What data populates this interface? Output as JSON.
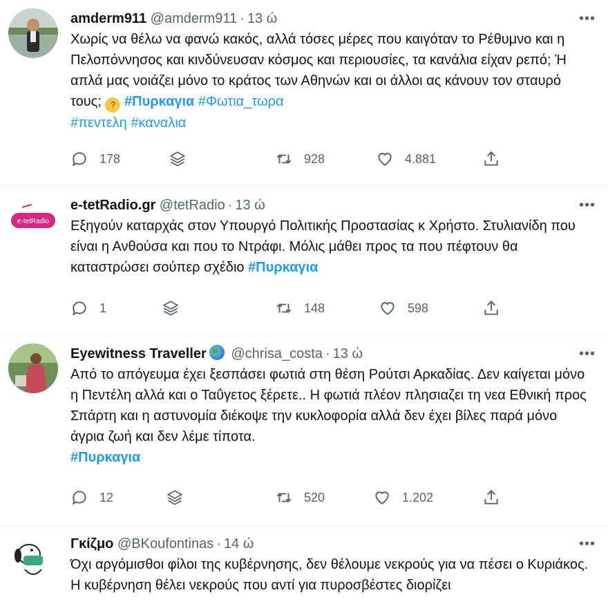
{
  "tweets": [
    {
      "name": "amderm911",
      "handle": "@amderm911",
      "time": "13 ώ",
      "text": "Χωρίς να θέλω να φανώ κακός, αλλά τόσες μέρες που καιγόταν το Ρέθυμνο και η Πελοπόννησος και κινδύνευσαν κόσμος και περιουσίες, τα κανάλια είχαν ρεπό; Ή απλά μας νοιάζει μόνο το κράτος των Αθηνών και οι άλλοι ας κάνουν τον σταυρό τους; ",
      "tags": [
        "#Πυρκαγια",
        "#Φωτια_τωρα",
        "#πεντελη",
        "#καναλια"
      ],
      "replies": "178",
      "retweets": "928",
      "likes": "4.881"
    },
    {
      "name": "e-tetRadio.gr",
      "handle": "@tetRadio",
      "time": "13 ώ",
      "avatar_text": "e-tetRadio",
      "text": "Εξηγούν καταρχάς στον Υπουργό Πολιτικής Προστασίας κ Χρήστο. Στυλιανίδη που είναι η Ανθούσα και που το Ντράφι. Μόλις μάθει προς τα που πέφτουν θα καταστρώσει σούπερ σχέδιο ",
      "tags": [
        "#Πυρκαγια"
      ],
      "replies": "1",
      "retweets": "148",
      "likes": "598"
    },
    {
      "name": "Eyewitness Traveller",
      "handle": "@chrisa_costa",
      "time": "13 ώ",
      "text": "Από το απόγευμα έχει ξεσπάσει φωτιά στη θέση Ρούτσι Αρκαδίας. Δεν καίγεται μόνο η Πεντέλη αλλά και ο Ταΰγετος ξέρετε.. Η φωτιά πλέον πλησιαζει τη νεα Εθνική προς Σπάρτη και η αστυνομία διέκοψε την κυκλοφορία αλλά δεν έχει βίλες παρά μόνο άγρια ζωή και δεν λέμε τίποτα.",
      "tags": [
        "#Πυρκαγια"
      ],
      "replies": "12",
      "retweets": "520",
      "likes": "1.202"
    },
    {
      "name": "Γκίζμο",
      "handle": "@BKoufontinas",
      "time": "14 ώ",
      "text": "Όχι αργόμισθοι φίλοι της κυβέρνησης, δεν θέλουμε νεκρούς για να πέσει ο Κυριάκος. Η κυβέρνηση θέλει νεκρούς που αντί για πυροσβέστες διορίζει"
    }
  ],
  "icons": {
    "more": "more-icon",
    "reply": "reply-icon",
    "layers": "layers-icon",
    "retweet": "retweet-icon",
    "like": "heart-icon",
    "share": "share-icon"
  },
  "colors": {
    "hashtag": "#1d9bf0",
    "secondary": "#536471",
    "divider": "#eff3f4"
  },
  "more_glyph": "•••"
}
